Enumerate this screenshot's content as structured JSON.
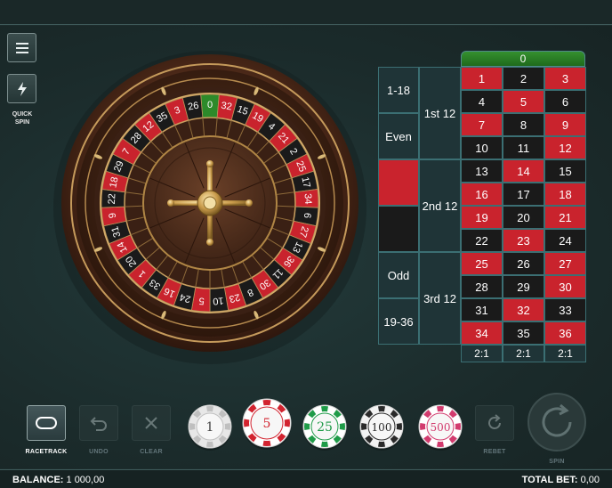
{
  "header": {},
  "menu": {
    "icon": "hamburger-menu-icon"
  },
  "quick_spin": {
    "icon": "lightning-icon",
    "label_line1": "QUICK",
    "label_line2": "SPIN"
  },
  "wheel": {
    "sequence": [
      "0",
      "32",
      "15",
      "19",
      "4",
      "21",
      "2",
      "25",
      "17",
      "34",
      "6",
      "27",
      "13",
      "36",
      "11",
      "30",
      "8",
      "23",
      "10",
      "5",
      "24",
      "16",
      "33",
      "1",
      "20",
      "14",
      "31",
      "9",
      "22",
      "18",
      "29",
      "7",
      "28",
      "12",
      "35",
      "3",
      "26"
    ],
    "reds": [
      "1",
      "3",
      "5",
      "7",
      "9",
      "12",
      "14",
      "16",
      "18",
      "19",
      "21",
      "23",
      "25",
      "27",
      "30",
      "32",
      "34",
      "36"
    ]
  },
  "board": {
    "zero": "0",
    "numbers": [
      [
        "1",
        "2",
        "3"
      ],
      [
        "4",
        "5",
        "6"
      ],
      [
        "7",
        "8",
        "9"
      ],
      [
        "10",
        "11",
        "12"
      ],
      [
        "13",
        "14",
        "15"
      ],
      [
        "16",
        "17",
        "18"
      ],
      [
        "19",
        "20",
        "21"
      ],
      [
        "22",
        "23",
        "24"
      ],
      [
        "25",
        "26",
        "27"
      ],
      [
        "28",
        "29",
        "30"
      ],
      [
        "31",
        "32",
        "33"
      ],
      [
        "34",
        "35",
        "36"
      ]
    ],
    "dozens": [
      "1st 12",
      "2nd 12",
      "3rd 12"
    ],
    "outside": [
      "1-18",
      "Even",
      "",
      "",
      "Odd",
      "19-36"
    ],
    "columns": [
      "2:1",
      "2:1",
      "2:1"
    ]
  },
  "controls": {
    "racetrack": "RACETRACK",
    "undo": "UNDO",
    "clear": "CLEAR",
    "rebet": "REBET",
    "spin": "SPIN"
  },
  "chips": [
    {
      "value": "1",
      "color": "#e7e7e7",
      "stripe": "#bfbfbf",
      "text": "#444444"
    },
    {
      "value": "5",
      "color": "#ffffff",
      "stripe": "#d2232f",
      "text": "#d2232f"
    },
    {
      "value": "25",
      "color": "#ffffff",
      "stripe": "#1f9b48",
      "text": "#1f9b48"
    },
    {
      "value": "100",
      "color": "#f2f2f2",
      "stripe": "#2a2a2a",
      "text": "#2a2a2a"
    },
    {
      "value": "500",
      "color": "#ffffff",
      "stripe": "#d23b6e",
      "text": "#d23b6e"
    }
  ],
  "footer": {
    "balance_label": "BALANCE:",
    "balance_value": "1 000,00",
    "total_bet_label": "TOTAL BET:",
    "total_bet_value": "0,00"
  },
  "colors": {
    "red": "#c9232d",
    "black": "#1a1a1a",
    "green": "#2d8a2a",
    "felt": "#1d2d2d"
  }
}
